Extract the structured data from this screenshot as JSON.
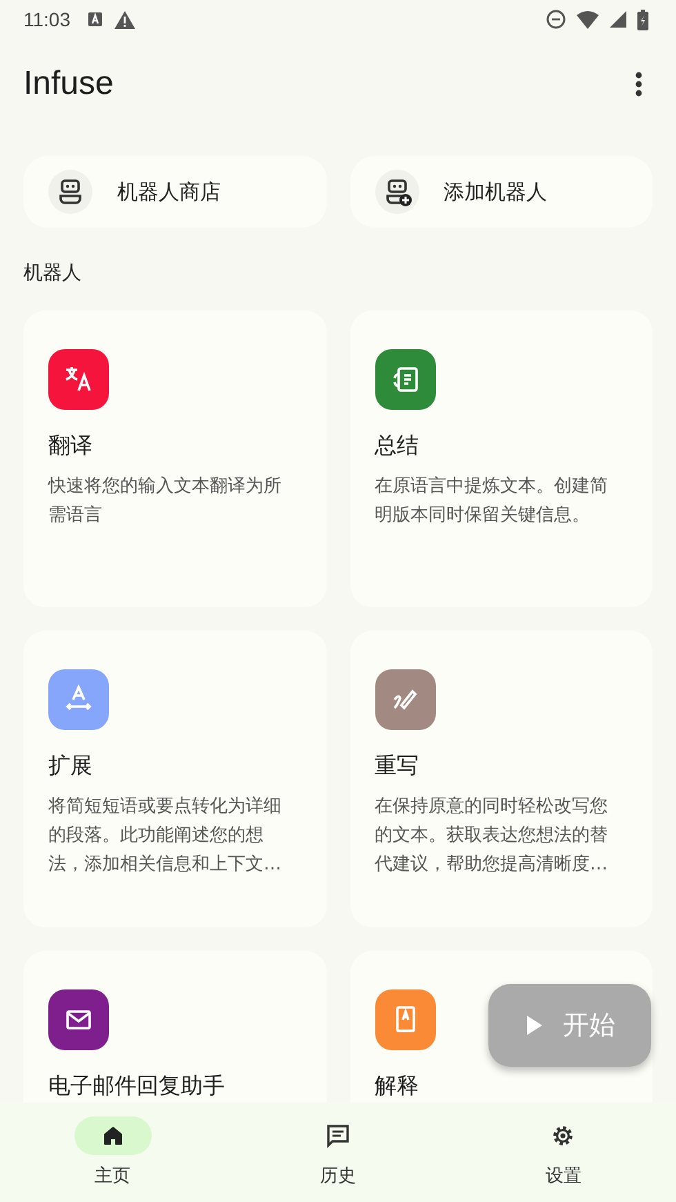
{
  "status_bar": {
    "time": "11:03"
  },
  "app_bar": {
    "title": "Infuse"
  },
  "quick_actions": [
    {
      "label": "机器人商店"
    },
    {
      "label": "添加机器人"
    }
  ],
  "section_title": "机器人",
  "bots": [
    {
      "title": "翻译",
      "description": "快速将您的输入文本翻译为所需语言",
      "color": "#f5143c"
    },
    {
      "title": "总结",
      "description": "在原语言中提炼文本。创建简明版本同时保留关键信息。",
      "color": "#2e8b3a"
    },
    {
      "title": "扩展",
      "description": "将简短短语或要点转化为详细的段落。此功能阐述您的想法，添加相关信息和上下文…",
      "color": "#86a6fb"
    },
    {
      "title": "重写",
      "description": "在保持原意的同时轻松改写您的文本。获取表达您想法的替代建议，帮助您提高清晰度…",
      "color": "#a28a82"
    },
    {
      "title": "电子邮件回复助手",
      "color": "#7f1f8e"
    },
    {
      "title": "解释",
      "color": "#fb8a36"
    }
  ],
  "fab": {
    "label": "开始"
  },
  "nav": [
    {
      "label": "主页",
      "selected": true
    },
    {
      "label": "历史",
      "selected": false
    },
    {
      "label": "设置",
      "selected": false
    }
  ]
}
